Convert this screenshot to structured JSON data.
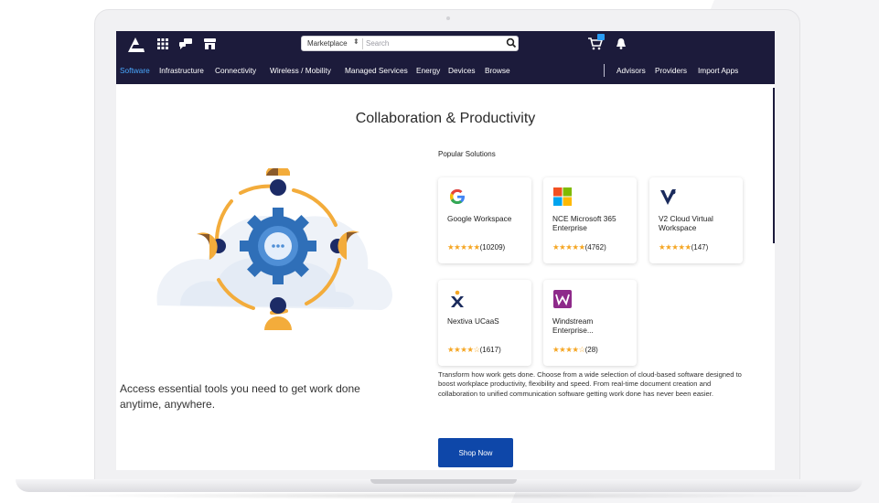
{
  "header": {
    "search_scope": "Marketplace",
    "search_placeholder": "Search",
    "icons": [
      "apps-grid-icon",
      "chat-icon",
      "store-icon",
      "cart-icon",
      "bell-icon"
    ]
  },
  "nav": {
    "left": [
      "Software",
      "Infrastructure",
      "Connectivity",
      "Wireless / Mobility",
      "Managed Services",
      "Energy",
      "Devices",
      "Browse"
    ],
    "right": [
      "Advisors",
      "Providers",
      "Import Apps"
    ],
    "active": "Software"
  },
  "page": {
    "title": "Collaboration & Productivity",
    "popular_label": "Popular Solutions",
    "tagline": "Access essential tools you need to get work done anytime, anywhere.",
    "description": "Transform how work gets done. Choose from a wide selection of cloud-based software designed to boost workplace productivity, flexibility and speed. From real-time document creation and collaboration to unified communication software getting work done has never been easier.",
    "cta": "Shop Now"
  },
  "solutions": [
    {
      "name": "Google Workspace",
      "stars": "★★★★★",
      "count": "(10209)",
      "logo": "google-logo-icon"
    },
    {
      "name": "NCE Microsoft 365 Enterprise",
      "stars": "★★★★★",
      "count": "(4762)",
      "logo": "microsoft-logo-icon"
    },
    {
      "name": "V2 Cloud Virtual Workspace",
      "stars": "★★★★★",
      "count": "(147)",
      "logo": "v2-cloud-logo-icon"
    },
    {
      "name": "Nextiva UCaaS",
      "stars": "★★★★☆",
      "count": "(1617)",
      "logo": "nextiva-logo-icon"
    },
    {
      "name": "Windstream Enterprise...",
      "stars": "★★★★☆",
      "count": "(28)",
      "logo": "windstream-logo-icon"
    }
  ],
  "colors": {
    "header_bg": "#1c1b3b",
    "active_nav": "#49a8ff",
    "cta_bg": "#0e47a9",
    "star": "#f5a623"
  }
}
